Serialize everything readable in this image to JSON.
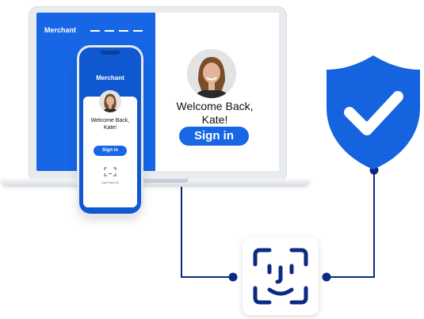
{
  "laptop": {
    "brand": "Merchant",
    "welcome_line1": "Welcome Back,",
    "welcome_line2": "Kate!",
    "signin_label": "Sign in"
  },
  "phone": {
    "brand": "Merchant",
    "welcome_line1": "Welcome Back,",
    "welcome_line2": "Kate!",
    "signin_label": "Sign in",
    "small_label": "Use Face ID",
    "bottom_label": "Contact us"
  },
  "colors": {
    "brand_blue": "#1666e5",
    "shield_blue": "#1563df",
    "connector": "#0c2a82"
  },
  "icons": [
    "shield-check-icon",
    "face-id-icon"
  ]
}
